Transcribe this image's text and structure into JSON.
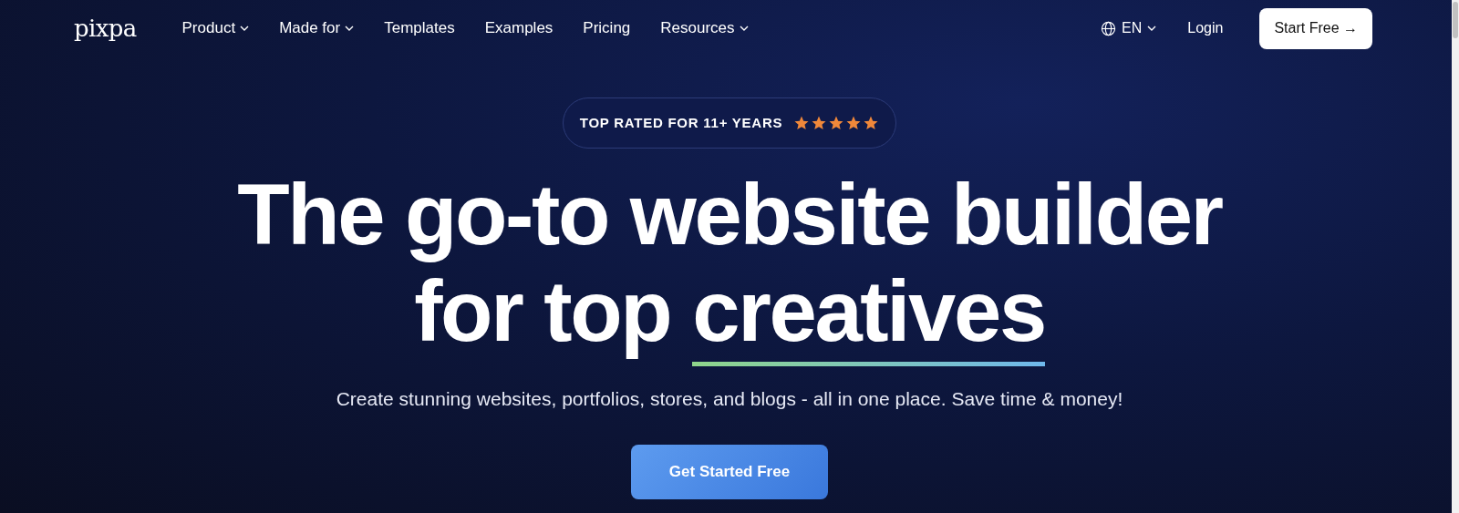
{
  "logo": "pixpa",
  "nav": [
    {
      "label": "Product",
      "dropdown": true
    },
    {
      "label": "Made for",
      "dropdown": true
    },
    {
      "label": "Templates",
      "dropdown": false
    },
    {
      "label": "Examples",
      "dropdown": false
    },
    {
      "label": "Pricing",
      "dropdown": false
    },
    {
      "label": "Resources",
      "dropdown": true
    }
  ],
  "language": "EN",
  "login": "Login",
  "start_button": "Start Free →",
  "badge": {
    "text": "TOP RATED FOR 11+ YEARS",
    "stars": 5
  },
  "headline": {
    "line_1": "The go-to website builder",
    "line_2_start": "for top",
    "line_2_underlined": "creatives"
  },
  "subtitle": "Create stunning websites, portfolios, stores, and blogs - all in one place. Save time & money!",
  "cta_button": "Get Started Free"
}
